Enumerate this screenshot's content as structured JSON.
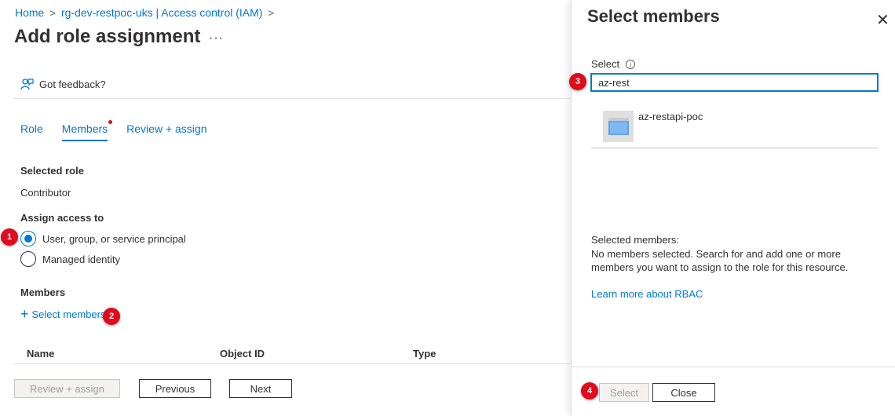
{
  "breadcrumb": {
    "home": "Home",
    "iam": "rg-dev-restpoc-uks | Access control (IAM)"
  },
  "page": {
    "title": "Add role assignment",
    "more": "···",
    "feedback": "Got feedback?"
  },
  "tabs": [
    {
      "label": "Role"
    },
    {
      "label": "Members"
    },
    {
      "label": "Review + assign"
    }
  ],
  "form": {
    "selected_role_label": "Selected role",
    "selected_role_value": "Contributor",
    "assign_access_label": "Assign access to",
    "option_user": "User, group, or service principal",
    "option_managed": "Managed identity",
    "members_label": "Members",
    "select_members_link": "Select members"
  },
  "table": {
    "col_name": "Name",
    "col_object_id": "Object ID",
    "col_type": "Type"
  },
  "footer": {
    "review_assign": "Review + assign",
    "previous": "Previous",
    "next": "Next"
  },
  "panel": {
    "title": "Select members",
    "field_label": "Select",
    "search_value": "az-rest",
    "result_name": "az-restapi-poc",
    "selected_members_title": "Selected members:",
    "selected_members_text": "No members selected. Search for and add one or more members you want to assign to the role for this resource.",
    "rbac_link": "Learn more about RBAC",
    "select_button": "Select",
    "close_button": "Close"
  },
  "annotations": [
    "1",
    "2",
    "3",
    "4"
  ],
  "colors": {
    "accent": "#0078d4",
    "badge": "#e00b1c"
  }
}
